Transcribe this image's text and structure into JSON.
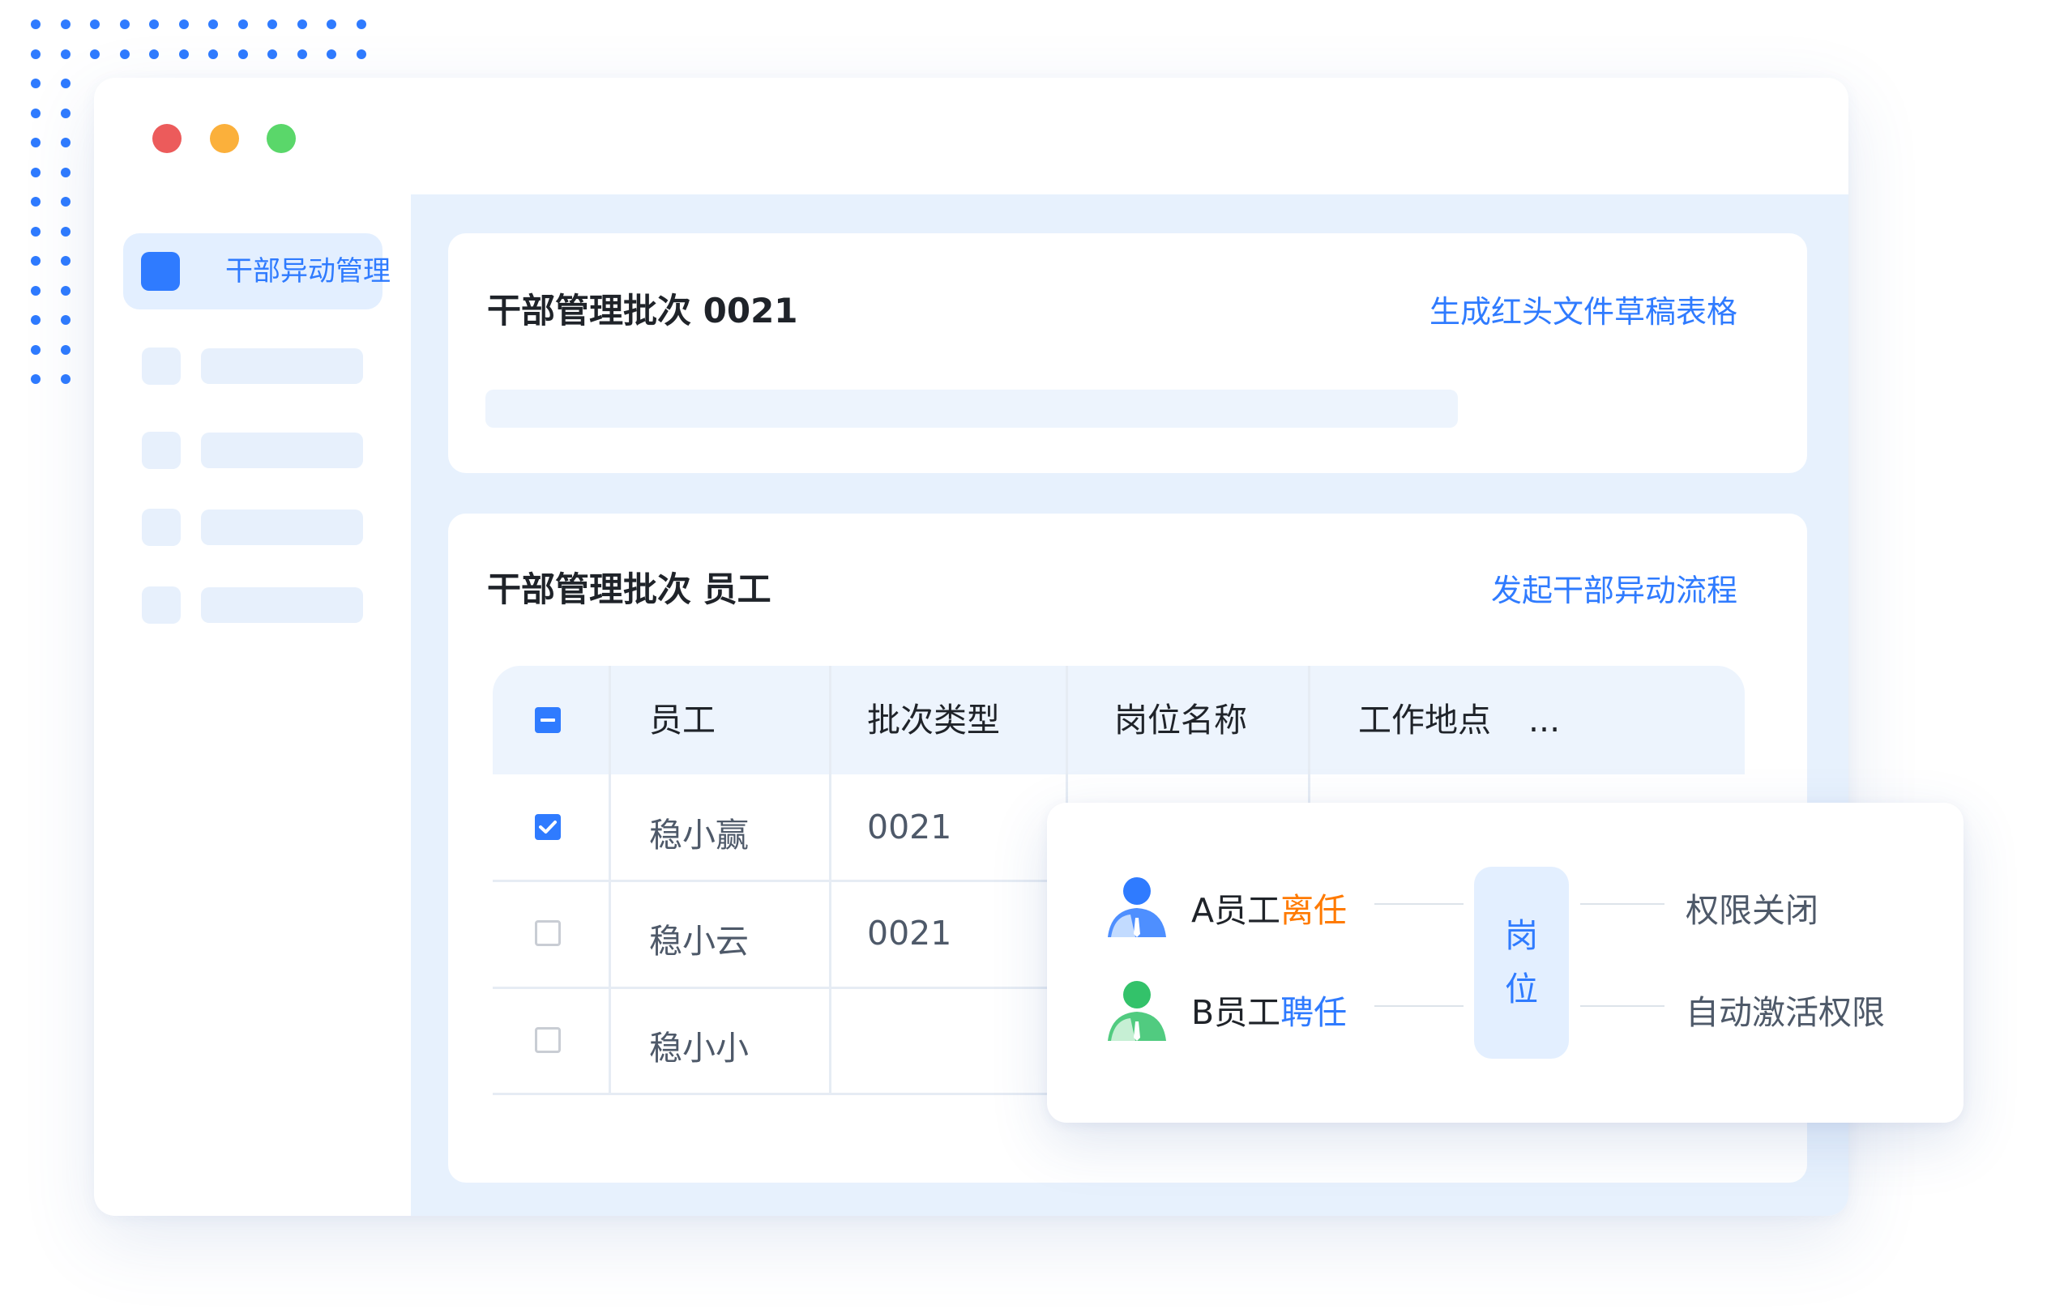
{
  "sidebar": {
    "active_item": {
      "label": "干部异动管理"
    }
  },
  "batch_card": {
    "title": "干部管理批次 0021",
    "action_link": "生成红头文件草稿表格"
  },
  "employee_card": {
    "title": "干部管理批次 员工",
    "action_link": "发起干部异动流程",
    "table": {
      "columns": [
        "员工",
        "批次类型",
        "岗位名称",
        "工作地点",
        "..."
      ],
      "header_checkbox": "indeterminate",
      "rows": [
        {
          "checked": true,
          "employee": "稳小赢",
          "batch_type": "0021"
        },
        {
          "checked": false,
          "employee": "稳小云",
          "batch_type": "0021"
        },
        {
          "checked": false,
          "employee": "稳小小",
          "batch_type": ""
        }
      ]
    }
  },
  "popup": {
    "left": [
      {
        "prefix": "A员工",
        "action": "离任",
        "action_color": "#ff7a00",
        "avatar_color": "#2f7bff"
      },
      {
        "prefix": "B员工",
        "action": "聘任",
        "action_color": "#2f7bff",
        "avatar_color": "#33c26a"
      }
    ],
    "center": [
      "岗",
      "位"
    ],
    "right": [
      "权限关闭",
      "自动激活权限"
    ]
  },
  "colors": {
    "accent": "#2f7bff",
    "orange": "#ff7a00",
    "background": "#e7f1fd"
  }
}
